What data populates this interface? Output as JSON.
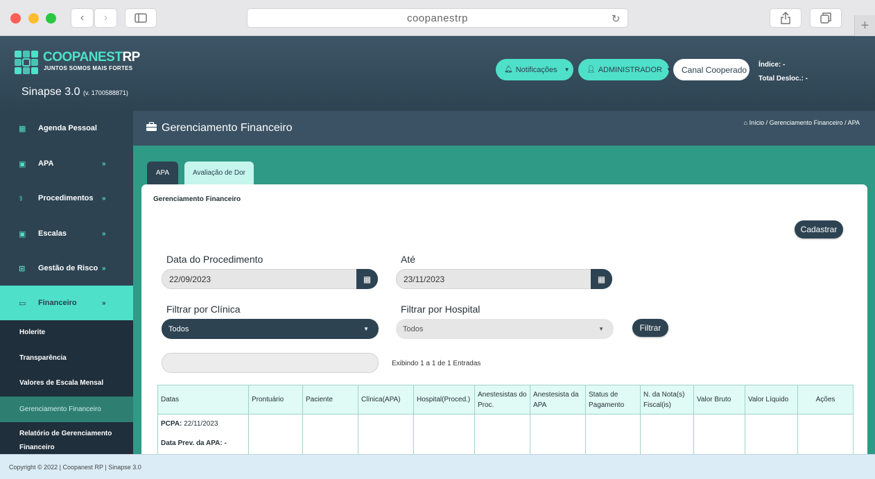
{
  "browser": {
    "url": "coopanestrp"
  },
  "header": {
    "brand_main": "COOPANEST",
    "brand_rp": "RP",
    "tagline": "JUNTOS SOMOS MAIS FORTES",
    "system_name": "Sinapse 3.0",
    "version": "(v. 1700588871)",
    "notifications_label": "Notificações",
    "user_label": "ADMINISTRADOR",
    "canal_label": "Canal Cooperado",
    "indice_label": "Índice: -",
    "total_desloc_label": "Total Desloc.: -",
    "accent_color": "#4fe0c9",
    "dark_color": "#2d4352"
  },
  "sidebar": {
    "items": [
      {
        "label": "Agenda Pessoal",
        "icon": "grid-calendar-icon"
      },
      {
        "label": "APA",
        "icon": "calendar-icon"
      },
      {
        "label": "Procedimentos",
        "icon": "stethoscope-icon"
      },
      {
        "label": "Escalas",
        "icon": "calendar-icon"
      },
      {
        "label": "Gestão de Risco",
        "icon": "plus-square-icon"
      },
      {
        "label": "Financeiro",
        "icon": "money-icon"
      }
    ],
    "submenu": [
      {
        "label": "Holerite"
      },
      {
        "label": "Transparência"
      },
      {
        "label": "Valores de Escala Mensal"
      },
      {
        "label": "Gerenciamento Financeiro"
      },
      {
        "label": "Relatório de Gerenciamento Financeiro"
      }
    ]
  },
  "main": {
    "page_title": "Gerenciamento Financeiro",
    "breadcrumb": "Início / Gerenciamento Financeiro / APA",
    "tabs": [
      {
        "label": "APA"
      },
      {
        "label": "Avaliação de Dor"
      }
    ],
    "panel_title": "Gerenciamento Financeiro",
    "cadastrar_label": "Cadastrar",
    "filters": {
      "date_from_label": "Data do Procedimento",
      "date_from_value": "22/09/2023",
      "date_to_label": "Até",
      "date_to_value": "23/11/2023",
      "clinic_label": "Filtrar por Clínica",
      "clinic_value": "Todos",
      "hospital_label": "Filtrar por Hospital",
      "hospital_value": "Todos",
      "filter_button": "Filtrar"
    },
    "search_value": "",
    "entries_text": "Exibindo 1 a 1 de 1 Entradas",
    "table": {
      "columns": [
        "Datas",
        "Prontuário",
        "Paciente",
        "Clínica(APA)",
        "Hospital(Proced.)",
        "Anestesistas do Proc.",
        "Anestesista da APA",
        "Status de Pagamento",
        "N. da Nota(s) Fiscal(is)",
        "Valor Bruto",
        "Valor Líquido",
        "Ações"
      ],
      "rows": [
        {
          "pcpa_label": "PCPA:",
          "pcpa_value": "22/11/2023",
          "prev_label": "Data Prev. da APA: -"
        }
      ]
    }
  },
  "footer": {
    "copyright": "Copyright © 2022 | Coopanest RP | Sinapse 3.0"
  }
}
